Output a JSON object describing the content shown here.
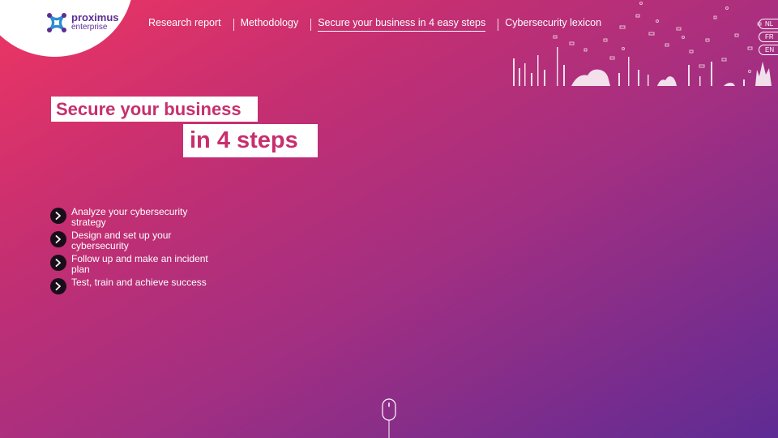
{
  "brand": {
    "name": "proximus",
    "sub": "enterprise",
    "colors": {
      "primary": "#5c2d91",
      "accent": "#c82e6d",
      "logo_blue": "#2e8bd4"
    }
  },
  "nav": {
    "items": [
      {
        "label": "Research report",
        "active": false
      },
      {
        "label": "Methodology",
        "active": false
      },
      {
        "label": "Secure your business in 4 easy steps",
        "active": true
      },
      {
        "label": "Cybersecurity lexicon",
        "active": false
      }
    ]
  },
  "languages": [
    "NL",
    "FR",
    "EN"
  ],
  "hero": {
    "title_line1": "Secure your business",
    "title_line2": "in 4 steps"
  },
  "steps": [
    "Analyze your cybersecurity strategy",
    "Design and set up your cybersecurity",
    "Follow up and make an incident plan",
    "Test, train and achieve success"
  ],
  "icons": {
    "step": "chevron-right-icon",
    "scroll": "scroll-mouse-icon",
    "logo": "proximus-logo-icon"
  }
}
